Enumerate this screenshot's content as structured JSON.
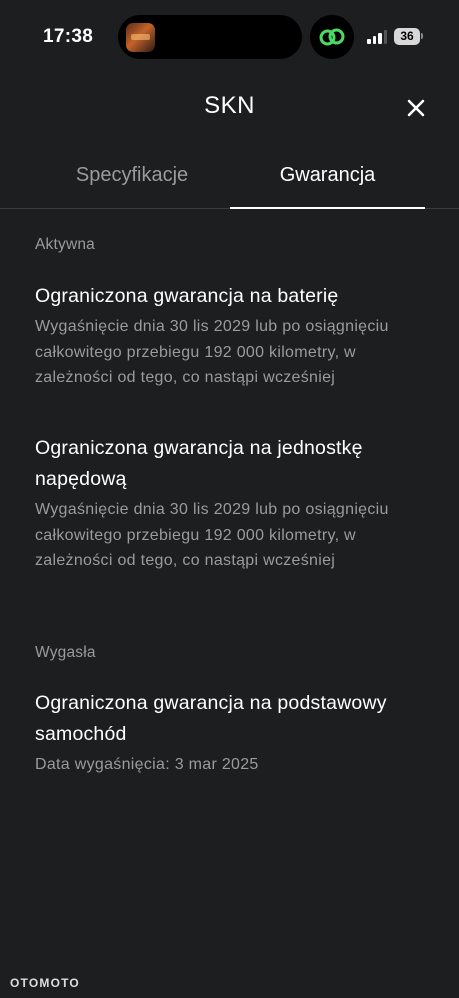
{
  "status_bar": {
    "time": "17:38",
    "battery": "36",
    "island_app_icon": "circles-link-icon",
    "accent": "#4cd964"
  },
  "header": {
    "title": "SKN",
    "close_icon": "close-icon"
  },
  "tabs": [
    {
      "label": "Specyfikacje",
      "active": false
    },
    {
      "label": "Gwarancja",
      "active": true
    }
  ],
  "active_section": {
    "label": "Aktywna",
    "items": [
      {
        "title": "Ograniczona gwarancja na baterię",
        "description": "Wygaśnięcie dnia 30 lis 2029 lub po osiągnięciu całkowitego przebiegu 192 000 kilometry, w zależności od tego, co nastąpi wcześniej"
      },
      {
        "title": "Ograniczona gwarancja na jednostkę napędową",
        "description": "Wygaśnięcie dnia 30 lis 2029 lub po osiągnięciu całkowitego przebiegu 192 000 kilometry, w zależności od tego, co nastąpi wcześniej"
      }
    ]
  },
  "expired_section": {
    "label": "Wygasła",
    "items": [
      {
        "title": "Ograniczona gwarancja na podstawowy samochód",
        "description": "Data wygaśnięcia: 3 mar 2025"
      }
    ]
  },
  "watermark": "OTOMOTO"
}
